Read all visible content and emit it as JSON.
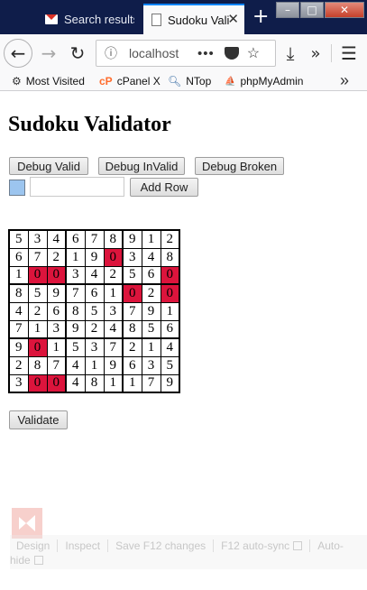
{
  "browser": {
    "tabs": [
      {
        "title": "Search results",
        "icon": "gmail-icon",
        "active": false
      },
      {
        "title": "Sudoku Validator",
        "icon": "page-icon",
        "active": true
      }
    ],
    "new_tab_symbol": "+",
    "window_controls": [
      "–",
      "□",
      "✕"
    ],
    "url": "localhost",
    "bookmarks": [
      {
        "label": "Most Visited",
        "icon": "gear-icon"
      },
      {
        "label": "cPanel X",
        "icon": "cpanel-icon"
      },
      {
        "label": "NTop",
        "icon": "search-icon"
      },
      {
        "label": "phpMyAdmin",
        "icon": "phpmyadmin-icon"
      }
    ]
  },
  "page": {
    "title": "Sudoku Validator",
    "buttons": {
      "debug_valid": "Debug Valid",
      "debug_invalid": "Debug InValid",
      "debug_broken": "Debug Broken",
      "add_row": "Add Row",
      "validate": "Validate"
    },
    "row_input_value": "",
    "swatch_color": "#9cc5ef",
    "error_color": "#dc143c",
    "grid": [
      [
        "5",
        "3",
        "4",
        "6",
        "7",
        "8",
        "9",
        "1",
        "2"
      ],
      [
        "6",
        "7",
        "2",
        "1",
        "9",
        "0",
        "3",
        "4",
        "8"
      ],
      [
        "1",
        "0",
        "0",
        "3",
        "4",
        "2",
        "5",
        "6",
        "0"
      ],
      [
        "8",
        "5",
        "9",
        "7",
        "6",
        "1",
        "0",
        "2",
        "0"
      ],
      [
        "4",
        "2",
        "6",
        "8",
        "5",
        "3",
        "7",
        "9",
        "1"
      ],
      [
        "7",
        "1",
        "3",
        "9",
        "2",
        "4",
        "8",
        "5",
        "6"
      ],
      [
        "9",
        "0",
        "1",
        "5",
        "3",
        "7",
        "2",
        "1",
        "4"
      ],
      [
        "2",
        "8",
        "7",
        "4",
        "1",
        "9",
        "6",
        "3",
        "5"
      ],
      [
        "3",
        "0",
        "0",
        "4",
        "8",
        "1",
        "1",
        "7",
        "9"
      ]
    ],
    "error_cells": [
      [
        1,
        5
      ],
      [
        2,
        1
      ],
      [
        2,
        2
      ],
      [
        2,
        8
      ],
      [
        3,
        6
      ],
      [
        3,
        8
      ],
      [
        6,
        1
      ],
      [
        8,
        1
      ],
      [
        8,
        2
      ]
    ]
  },
  "devbar": {
    "design": "Design",
    "inspect": "Inspect",
    "save": "Save F12 changes",
    "autosync": "F12 auto-sync",
    "autohide_line1": "Auto-",
    "autohide_line2": "hide"
  }
}
